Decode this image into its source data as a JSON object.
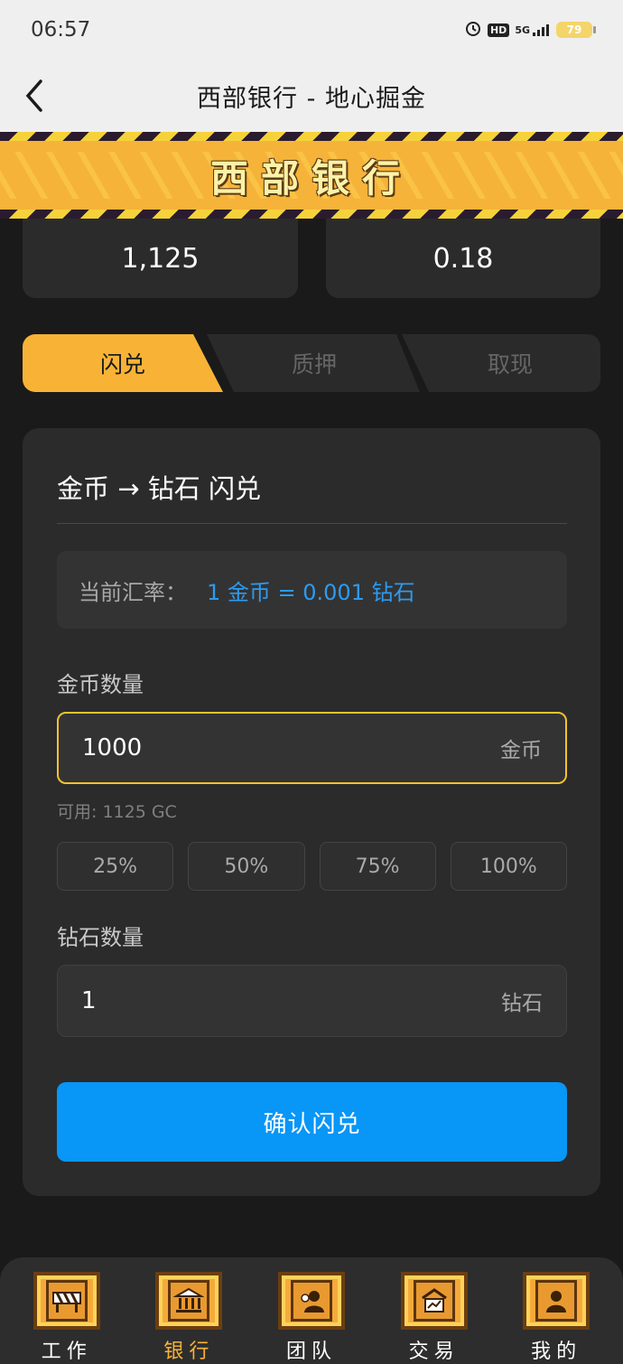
{
  "status_bar": {
    "time": "06:57",
    "network": "5G",
    "hd": "HD",
    "battery": "79"
  },
  "nav": {
    "title": "西部银行 - 地心掘金"
  },
  "banner": {
    "title": "西部银行"
  },
  "stats": {
    "left_value": "1,125",
    "right_value": "0.18"
  },
  "tabs": [
    {
      "label": "闪兑",
      "active": true
    },
    {
      "label": "质押",
      "active": false
    },
    {
      "label": "取现",
      "active": false
    }
  ],
  "panel": {
    "title": "金币 → 钻石 闪兑",
    "rate_label": "当前汇率：",
    "rate_value": "1 金币 = 0.001 钻石",
    "gold_label": "金币数量",
    "gold_value": "1000",
    "gold_unit": "金币",
    "available": "可用: 1125 GC",
    "percent_buttons": [
      "25%",
      "50%",
      "75%",
      "100%"
    ],
    "diamond_label": "钻石数量",
    "diamond_value": "1",
    "diamond_unit": "钻石",
    "confirm_label": "确认闪兑"
  },
  "bottom_nav": [
    {
      "label": "工作",
      "icon": "barrier-icon",
      "active": false
    },
    {
      "label": "银行",
      "icon": "bank-icon",
      "active": true
    },
    {
      "label": "团队",
      "icon": "team-icon",
      "active": false
    },
    {
      "label": "交易",
      "icon": "trade-icon",
      "active": false
    },
    {
      "label": "我的",
      "icon": "profile-icon",
      "active": false
    }
  ],
  "colors": {
    "accent": "#f8b336",
    "primary_button": "#0896f7",
    "rate_text": "#2c9bf0"
  }
}
